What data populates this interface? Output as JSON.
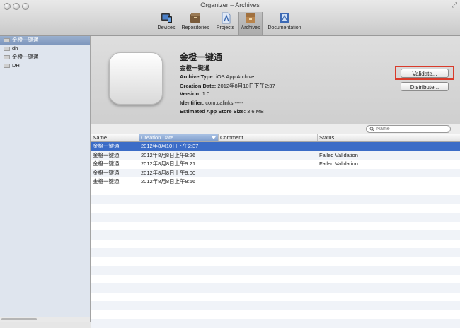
{
  "window": {
    "title": "Organizer – Archives"
  },
  "toolbar": {
    "items": [
      {
        "label": "Devices",
        "icon": "devices-icon"
      },
      {
        "label": "Repositories",
        "icon": "repositories-icon"
      },
      {
        "label": "Projects",
        "icon": "projects-icon"
      },
      {
        "label": "Archives",
        "icon": "archives-icon",
        "selected": true
      },
      {
        "label": "Documentation",
        "icon": "documentation-icon"
      }
    ]
  },
  "sidebar": {
    "items": [
      {
        "label": "金橙一键通",
        "selected": true
      },
      {
        "label": "dh"
      },
      {
        "label": "金橙一键通"
      },
      {
        "label": "DH"
      }
    ]
  },
  "detail": {
    "name": "金橙一键通",
    "subtitle": "金橙一键通",
    "archive_type_label": "Archive Type:",
    "archive_type": "iOS App Archive",
    "creation_date_label": "Creation Date:",
    "creation_date": "2012年8月10日下午2:37",
    "version_label": "Version:",
    "version": "1.0",
    "identifier_label": "Identifier:",
    "identifier": "com.calinks.-----",
    "size_label": "Estimated App Store Size:",
    "size": "3.6 MB",
    "validate_label": "Validate...",
    "distribute_label": "Distribute..."
  },
  "search": {
    "placeholder": "Name"
  },
  "table": {
    "columns": [
      "Name",
      "Creation Date",
      "Comment",
      "Status"
    ],
    "rows": [
      {
        "name": "金橙一键通",
        "date": "2012年8月10日下午2:37",
        "comment": "",
        "status": ""
      },
      {
        "name": "金橙一键通",
        "date": "2012年8月8日上午9:26",
        "comment": "",
        "status": "Failed Validation"
      },
      {
        "name": "金橙一键通",
        "date": "2012年8月8日上午9:21",
        "comment": "",
        "status": "Failed Validation"
      },
      {
        "name": "金橙一键通",
        "date": "2012年8月8日上午9:00",
        "comment": "",
        "status": ""
      },
      {
        "name": "金橙一键通",
        "date": "2012年8月8日上午8:56",
        "comment": "",
        "status": ""
      }
    ]
  },
  "colors": {
    "selection": "#3b6cc7",
    "highlight_box": "#d93b2b"
  }
}
